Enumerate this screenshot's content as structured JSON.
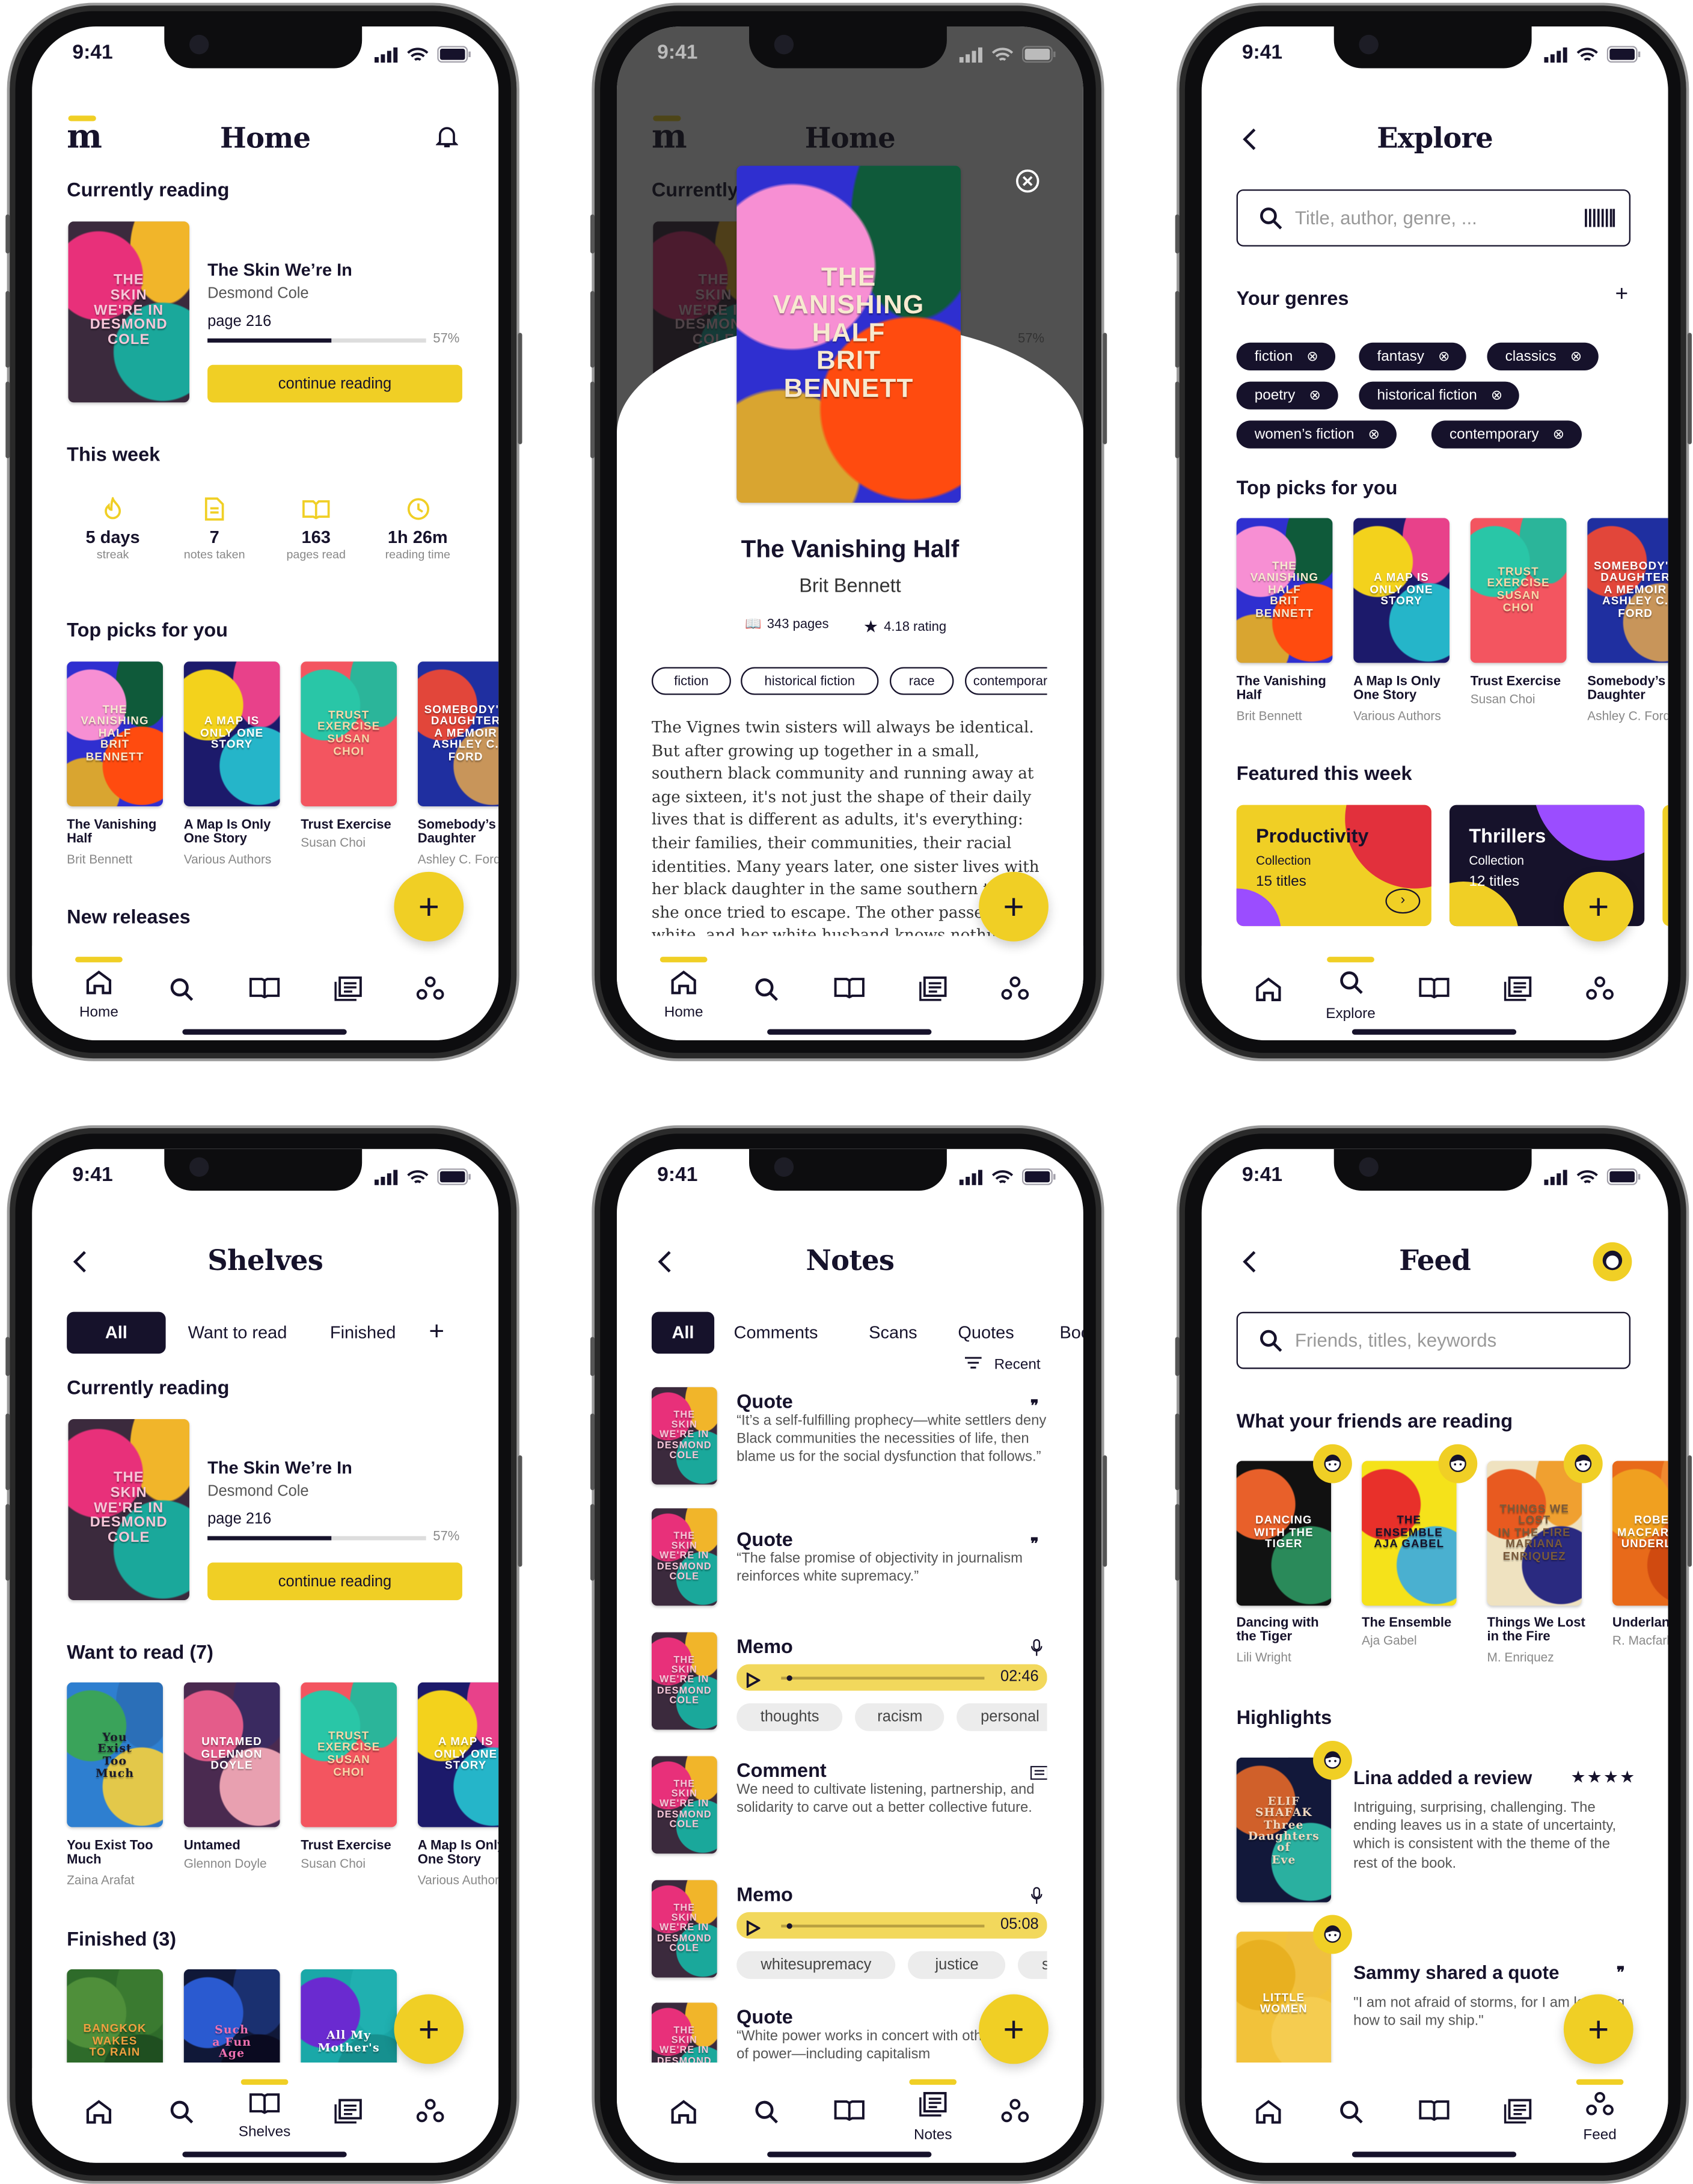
{
  "colors": {
    "navy": "#16122b",
    "yellow": "#f0cf25",
    "gray": "#888888",
    "overlay": "#444444"
  },
  "status": {
    "time": "9:41",
    "icons": [
      "signal-icon",
      "wifi-icon",
      "battery-icon"
    ]
  },
  "nav": {
    "items": [
      {
        "icon": "home-icon",
        "label": "Home"
      },
      {
        "icon": "search-icon",
        "label": "Explore"
      },
      {
        "icon": "book-open-icon",
        "label": "Shelves"
      },
      {
        "icon": "notes-icon",
        "label": "Notes"
      },
      {
        "icon": "people-icon",
        "label": "Feed"
      }
    ]
  },
  "fab_label": "+",
  "covers": {
    "skin": {
      "bg": [
        "#3b2a3d",
        "#e8307a",
        "#1aa89b",
        "#f1b52a"
      ],
      "fg": "#f6c7d8",
      "text": [
        "THE",
        "SKIN",
        "WE'RE IN",
        "DESMOND COLE"
      ]
    },
    "vanishing": {
      "bg": [
        "#2f2fd0",
        "#f78fd3",
        "#ff4b0f",
        "#0f5a3a",
        "#d9a530"
      ],
      "fg": "#f7ead0",
      "text": [
        "THE",
        "VANISHING",
        "HALF",
        "BRIT",
        "BENNETT"
      ]
    },
    "map": {
      "bg": [
        "#1c1a6b",
        "#f3d21c",
        "#25b5c9",
        "#e8418a"
      ],
      "fg": "#ffffff",
      "text": [
        "A MAP IS",
        "ONLY ONE",
        "STORY"
      ]
    },
    "trust": {
      "bg": [
        "#f35560",
        "#29c6a7",
        "#f35560",
        "#2bb59a"
      ],
      "fg": "#f9d7a8",
      "text": [
        "TRUST",
        "EXERCISE",
        "SUSAN",
        "CHOI"
      ]
    },
    "somebody": {
      "bg": [
        "#1f2fa0",
        "#e2463a",
        "#c8955a",
        "#1f2fa0"
      ],
      "fg": "#ffffff",
      "text": [
        "SOMEBODY'S",
        "DAUGHTER",
        "A MEMOIR",
        "ASHLEY C. FORD"
      ]
    },
    "youexist": {
      "bg": [
        "#2e7fd0",
        "#3aa35a",
        "#e3c84a",
        "#2b6fb8"
      ],
      "fg": "#1a1a2a",
      "text": [
        "You",
        "Exist",
        "Too",
        "Much"
      ],
      "serif": true
    },
    "untamed": {
      "bg": [
        "#4a2a50",
        "#e45c8a",
        "#e8a0b0",
        "#3a2a60"
      ],
      "fg": "#ffffff",
      "text": [
        "UNTAMED",
        "GLENNON",
        "DOYLE"
      ]
    },
    "bangkok": {
      "bg": [
        "#2e6b2a",
        "#4f8f3a",
        "#1f4f20",
        "#3a7a30"
      ],
      "fg": "#f0a040",
      "text": [
        "BANGKOK",
        "WAKES",
        "TO RAIN"
      ]
    },
    "suchafun": {
      "bg": [
        "#101838",
        "#2a5ad0",
        "#0a0a20",
        "#1a3070"
      ],
      "fg": "#f070b0",
      "text": [
        "Such",
        "a Fun",
        "Age"
      ],
      "serif": true
    },
    "allmy": {
      "bg": [
        "#1aa8a8",
        "#6a2ad0",
        "#16908f",
        "#20b0b0"
      ],
      "fg": "#ffffff",
      "text": [
        "All My",
        "Mother's"
      ],
      "serif": true
    },
    "dancing": {
      "bg": [
        "#111111",
        "#e8602a",
        "#2a8a5a",
        "#111111"
      ],
      "fg": "#ffffff",
      "text": [
        "DANCING",
        "WITH THE",
        "TIGER"
      ]
    },
    "ensemble": {
      "bg": [
        "#f5e21a",
        "#e8302a",
        "#4ab0d0",
        "#f5e21a"
      ],
      "fg": "#16122b",
      "text": [
        "THE",
        "ENSEMBLE",
        "AJA GABEL"
      ]
    },
    "things": {
      "bg": [
        "#efe2c0",
        "#e85a20",
        "#2a2a80",
        "#f0a030"
      ],
      "fg": "#7a5a3a",
      "text": [
        "THINGS WE LOST",
        "IN THE FIRE",
        "MARIANA ENRIQUEZ"
      ]
    },
    "underland": {
      "bg": [
        "#e86a1a",
        "#f0a020",
        "#d04a10",
        "#f08a30"
      ],
      "fg": "#ffffff",
      "text": [
        "ROBERT",
        "MACFARLANE",
        "UNDERLAND"
      ]
    },
    "elif": {
      "bg": [
        "#12183a",
        "#d0602a",
        "#2ab0a0",
        "#12183a"
      ],
      "fg": "#f0d8c0",
      "text": [
        "ELIF",
        "SHAFAK",
        "Three",
        "Daughters",
        "of",
        "Eve"
      ],
      "serif": true
    },
    "little": {
      "bg": [
        "#f2c23a",
        "#e8b020",
        "#f5cc50",
        "#f0c040"
      ],
      "fg": "#ffffff",
      "text": [
        "LITTLE",
        "WOMEN"
      ]
    }
  },
  "home": {
    "logo": "m",
    "title": "Home",
    "bell_icon": "bell-icon",
    "currently_reading": "Currently reading",
    "current_book": {
      "title": "The Skin We’re In",
      "author": "Desmond Cole",
      "page": "page 216",
      "progress_percent": 57,
      "progress_label": "57%",
      "button": "continue reading"
    },
    "this_week": "This week",
    "stats": [
      {
        "icon": "flame-icon",
        "value": "5 days",
        "label": "streak"
      },
      {
        "icon": "note-icon",
        "value": "7",
        "label": "notes taken"
      },
      {
        "icon": "book-open-icon",
        "value": "163",
        "label": "pages read"
      },
      {
        "icon": "clock-icon",
        "value": "1h 26m",
        "label": "reading time"
      }
    ],
    "top_picks": "Top picks for you",
    "picks": [
      {
        "cover": "vanishing",
        "title": "The Vanishing Half",
        "author": "Brit Bennett"
      },
      {
        "cover": "map",
        "title": "A Map Is Only One Story",
        "author": "Various Authors"
      },
      {
        "cover": "trust",
        "title": "Trust Exercise",
        "author": "Susan Choi"
      },
      {
        "cover": "somebody",
        "title": "Somebody’s Daughter",
        "author": "Ashley C. Ford"
      }
    ],
    "new_releases": "New releases"
  },
  "detail": {
    "title": "The Vanishing Half",
    "author": "Brit Bennett",
    "pages": "343 pages",
    "rating": "4.18 rating",
    "tags": [
      "fiction",
      "historical fiction",
      "race",
      "contemporary"
    ],
    "description": "The Vignes twin sisters will always be identical. But after growing up together in a small, southern black community and running away at age sixteen, it's not just the shape of their daily lives that is different as adults, it's everything: their families, their communities, their racial identities. Many years later, one sister lives with her black daughter in the same southern town she once tried to escape. The other passes for white, and her white husband knows nothing of her past. Still, even separated"
  },
  "explore": {
    "title": "Explore",
    "search_placeholder": "Title, author, genre, ...",
    "your_genres": "Your genres",
    "genres": [
      "fiction",
      "fantasy",
      "classics",
      "poetry",
      "historical fiction",
      "women’s fiction",
      "contemporary"
    ],
    "top_picks": "Top picks for you",
    "featured": "Featured this week",
    "collections": [
      {
        "name": "Productivity",
        "type": "Collection",
        "count": "15 titles"
      },
      {
        "name": "Thrillers",
        "type": "Collection",
        "count": "12 titles"
      }
    ]
  },
  "shelves": {
    "title": "Shelves",
    "tabs": [
      "All",
      "Want to read",
      "Finished"
    ],
    "currently_reading": "Currently reading",
    "want_to_read": "Want to read (7)",
    "want_books": [
      {
        "cover": "youexist",
        "title": "You Exist Too Much",
        "author": "Zaina Arafat"
      },
      {
        "cover": "untamed",
        "title": "Untamed",
        "author": "Glennon Doyle"
      },
      {
        "cover": "trust",
        "title": "Trust Exercise",
        "author": "Susan Choi"
      },
      {
        "cover": "map",
        "title": "A Map Is Only One Story",
        "author": "Various Authors"
      }
    ],
    "finished": "Finished (3)",
    "finished_books": [
      {
        "cover": "bangkok"
      },
      {
        "cover": "suchafun"
      },
      {
        "cover": "allmy"
      }
    ]
  },
  "notes": {
    "title": "Notes",
    "tabs": [
      "All",
      "Comments",
      "Scans",
      "Quotes",
      "Bookmarks"
    ],
    "sort": "Recent",
    "items": [
      {
        "type": "Quote",
        "icon": "quote-icon",
        "text": "“It’s a self-fulfilling prophecy—white settlers deny Black communities the necessities of life, then blame us for the social dysfunction that follows.”"
      },
      {
        "type": "Quote",
        "icon": "quote-icon",
        "text": "“The false promise of objectivity in journalism reinforces white supremacy.”"
      },
      {
        "type": "Memo",
        "icon": "mic-icon",
        "duration": "02:46",
        "playback_percent": 3,
        "tags": [
          "thoughts",
          "racism",
          "personal"
        ]
      },
      {
        "type": "Comment",
        "icon": "comment-icon",
        "text": "We need to cultivate listening, partnership, and solidarity to carve out a better collective future."
      },
      {
        "type": "Memo",
        "icon": "mic-icon",
        "duration": "05:08",
        "playback_percent": 3,
        "tags": [
          "whitesupremacy",
          "justice",
          "sharing"
        ]
      },
      {
        "type": "Quote",
        "icon": "quote-icon",
        "text": "“White power works in concert with other forms of power—including capitalism"
      }
    ]
  },
  "feed": {
    "title": "Feed",
    "search_placeholder": "Friends, titles, keywords",
    "friends_reading": "What your friends are reading",
    "friend_books": [
      {
        "cover": "dancing",
        "title": "Dancing with the Tiger",
        "author": "Lili Wright"
      },
      {
        "cover": "ensemble",
        "title": "The Ensemble",
        "author": "Aja Gabel"
      },
      {
        "cover": "things",
        "title": "Things We Lost in the Fire",
        "author": "M. Enriquez"
      },
      {
        "cover": "underland",
        "title": "Underland",
        "author": "R. Macfarlane"
      }
    ],
    "highlights": "Highlights",
    "highlight_items": [
      {
        "cover": "elif",
        "heading": "Lina added a review",
        "rating": 4,
        "stars": "★★★★",
        "text": "Intriguing, surprising, challenging. The ending leaves us in a state of uncertainty, which is consistent with the theme of the rest of the book."
      },
      {
        "cover": "little",
        "heading": "Sammy shared a quote",
        "icon": "quote-icon",
        "text": "\"I am not afraid of storms, for I am learning how to sail my ship.\""
      }
    ]
  }
}
